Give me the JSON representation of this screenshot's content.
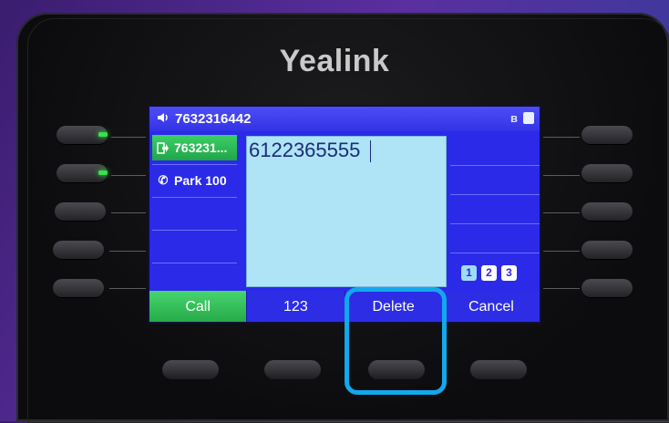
{
  "phone": {
    "brand": "Yealink",
    "status_bar": {
      "speaker_icon": "speaker-icon",
      "number": "7632316442",
      "bluetooth_icon": "bluetooth-icon",
      "lock_icon": "lock-icon"
    },
    "line_keys": [
      {
        "label": "763231...",
        "icon": "exit-arrow-icon",
        "active": true
      },
      {
        "label": "Park 100",
        "icon": "phone-park-icon",
        "active": false
      }
    ],
    "dial_entry": {
      "value": "6122365555"
    },
    "pages": [
      "1",
      "2",
      "3"
    ],
    "selected_page": "1",
    "softkeys": [
      {
        "label": "Call"
      },
      {
        "label": "123"
      },
      {
        "label": "Delete"
      },
      {
        "label": "Cancel"
      }
    ],
    "colors": {
      "screen_bg": "#2a2ae8",
      "active_green": "#24a847",
      "highlight": "#12a8ec"
    }
  }
}
